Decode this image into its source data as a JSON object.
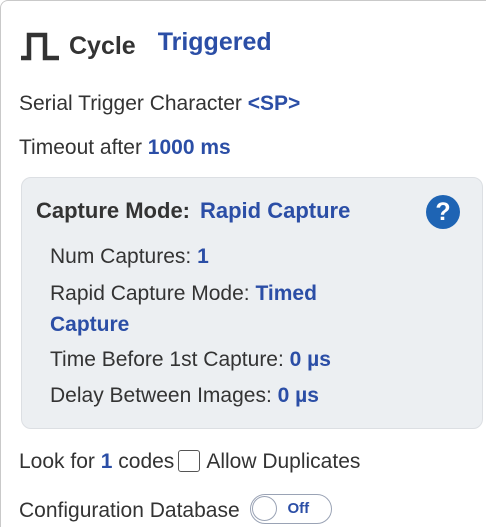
{
  "cycle": {
    "label": "Cycle",
    "value": "Triggered"
  },
  "trigger": {
    "serial_label": "Serial Trigger Character",
    "serial_value": "<SP>",
    "timeout_label": "Timeout after",
    "timeout_value": "1000 ms"
  },
  "capture": {
    "mode_label": "Capture Mode:",
    "mode_value": "Rapid Capture",
    "help_symbol": "?",
    "num_captures_label": "Num Captures:",
    "num_captures_value": "1",
    "rapid_mode_label": "Rapid Capture Mode:",
    "rapid_mode_value_line1": "Timed",
    "rapid_mode_value_line2": "Capture",
    "time_before_label": "Time Before 1st Capture:",
    "time_before_value": "0 µs",
    "delay_label": "Delay Between Images:",
    "delay_value": "0 µs"
  },
  "codes": {
    "look_for_label": "Look for",
    "count": "1",
    "codes_label": "codes",
    "allow_duplicates_label": "Allow Duplicates",
    "allow_duplicates_checked": false
  },
  "config_db": {
    "label": "Configuration Database",
    "toggle_text": "Off"
  },
  "colors": {
    "accent": "#2b4ea6",
    "help_icon": "#1e64b4",
    "box_background": "#eceff2"
  },
  "icons": {
    "cycle": "pulse-wave-icon",
    "help": "help-icon"
  }
}
